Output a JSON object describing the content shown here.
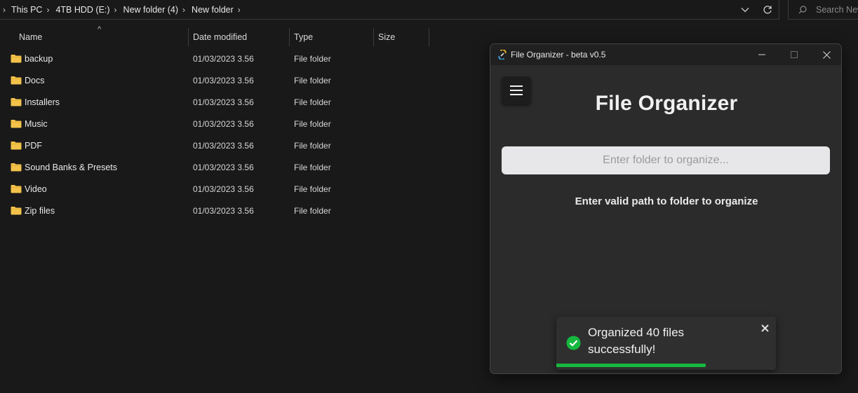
{
  "explorer": {
    "breadcrumb": [
      "This PC",
      "4TB HDD (E:)",
      "New folder (4)",
      "New folder"
    ],
    "search_placeholder": "Search New folder",
    "columns": {
      "name": "Name",
      "date": "Date modified",
      "type": "Type",
      "size": "Size"
    },
    "files": [
      {
        "name": "backup",
        "date": "01/03/2023 3.56",
        "type": "File folder",
        "size": ""
      },
      {
        "name": "Docs",
        "date": "01/03/2023 3.56",
        "type": "File folder",
        "size": ""
      },
      {
        "name": "Installers",
        "date": "01/03/2023 3.56",
        "type": "File folder",
        "size": ""
      },
      {
        "name": "Music",
        "date": "01/03/2023 3.56",
        "type": "File folder",
        "size": ""
      },
      {
        "name": "PDF",
        "date": "01/03/2023 3.56",
        "type": "File folder",
        "size": ""
      },
      {
        "name": "Sound Banks & Presets",
        "date": "01/03/2023 3.56",
        "type": "File folder",
        "size": ""
      },
      {
        "name": "Video",
        "date": "01/03/2023 3.56",
        "type": "File folder",
        "size": ""
      },
      {
        "name": "Zip files",
        "date": "01/03/2023 3.56",
        "type": "File folder",
        "size": ""
      }
    ]
  },
  "organizer": {
    "window_title": "File Organizer - beta v0.5",
    "heading": "File Organizer",
    "input_placeholder": "Enter folder to organize...",
    "input_value": "",
    "hint": "Enter valid path to folder to organize",
    "toast": {
      "message": "Organized 40 files successfully!",
      "progress": 0.68,
      "color": "#16b83f"
    }
  },
  "colors": {
    "folder": "#f3c24a",
    "background": "#191919",
    "window": "#2b2b2b",
    "success": "#16b83f"
  }
}
